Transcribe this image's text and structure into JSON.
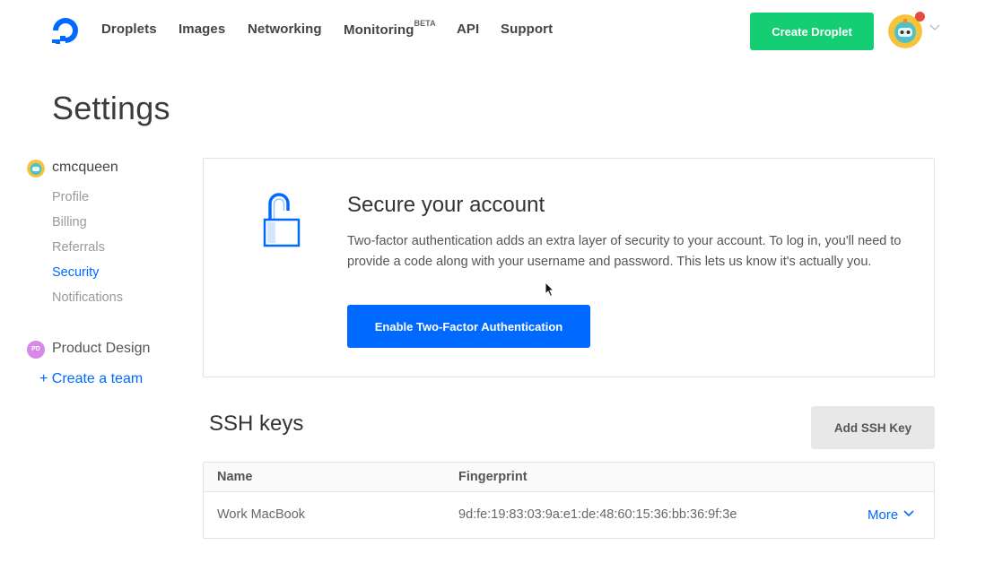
{
  "nav": {
    "items": [
      {
        "label": "Droplets"
      },
      {
        "label": "Images"
      },
      {
        "label": "Networking"
      },
      {
        "label": "Monitoring",
        "badge": "BETA"
      },
      {
        "label": "API"
      },
      {
        "label": "Support"
      }
    ],
    "create_button": "Create Droplet"
  },
  "page": {
    "title": "Settings"
  },
  "sidebar": {
    "user": "cmcqueen",
    "links": [
      {
        "label": "Profile"
      },
      {
        "label": "Billing"
      },
      {
        "label": "Referrals"
      },
      {
        "label": "Security",
        "active": true
      },
      {
        "label": "Notifications"
      }
    ],
    "team": {
      "initials": "PD",
      "name": "Product Design"
    },
    "create_team": "+ Create a team"
  },
  "secure": {
    "title": "Secure your account",
    "description": "Two-factor authentication adds an extra layer of security to your account. To log in, you'll need to provide a code along with your username and password. This lets us know it's actually you.",
    "button": "Enable Two-Factor Authentication"
  },
  "ssh": {
    "title": "SSH keys",
    "add_button": "Add SSH Key",
    "columns": [
      "Name",
      "Fingerprint"
    ],
    "rows": [
      {
        "name": "Work MacBook",
        "fingerprint": "9d:fe:19:83:03:9a:e1:de:48:60:15:36:bb:36:9f:3e",
        "action": "More"
      }
    ]
  },
  "colors": {
    "accent": "#0069ff",
    "create_green": "#15cd72",
    "notification": "#e84b3a"
  },
  "icons": [
    "digitalocean-logo-icon",
    "user-avatar-icon",
    "chevron-down-icon",
    "lock-open-icon",
    "cursor-icon"
  ]
}
